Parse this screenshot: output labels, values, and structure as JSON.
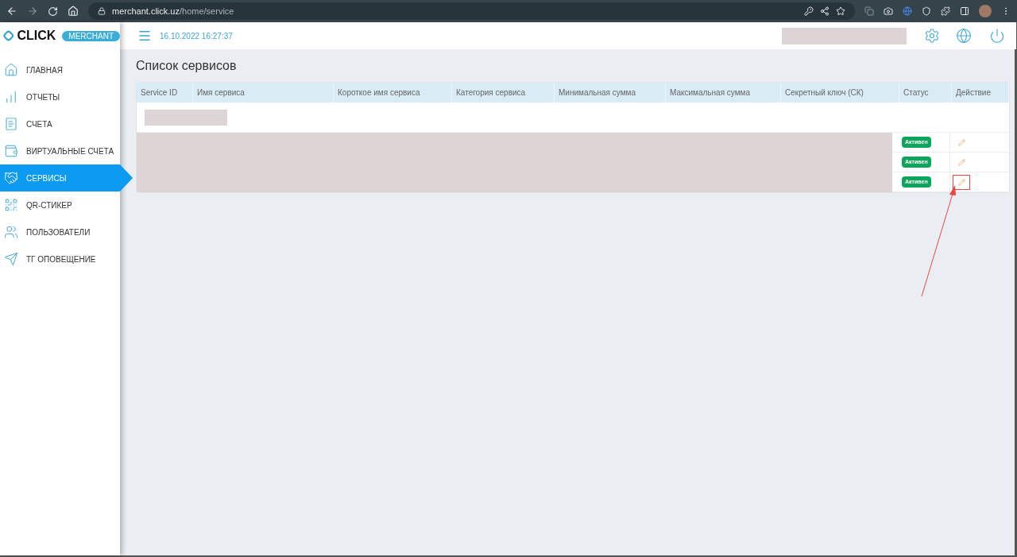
{
  "browser": {
    "url_host": "merchant.click.uz",
    "url_path": "/home/service"
  },
  "logo": {
    "name": "CLICK",
    "badge": "MERCHANT"
  },
  "header": {
    "datetime": "16.10.2022 16:27:37"
  },
  "sidebar": {
    "items": [
      {
        "label": "ГЛАВНАЯ",
        "selected": false
      },
      {
        "label": "ОТЧЕТЫ",
        "selected": false
      },
      {
        "label": "СЧЕТА",
        "selected": false
      },
      {
        "label": "ВИРТУАЛЬНЫЕ СЧЕТА",
        "selected": false
      },
      {
        "label": "СЕРВИСЫ",
        "selected": true
      },
      {
        "label": "QR-СТИКЕР",
        "selected": false
      },
      {
        "label": "ПОЛЬЗОВАТЕЛИ",
        "selected": false
      },
      {
        "label": "ТГ ОПОВЕЩЕНИЕ",
        "selected": false
      }
    ]
  },
  "page": {
    "title": "Список сервисов"
  },
  "table": {
    "columns": [
      "Service ID",
      "Имя сервиса",
      "Короткое имя сервиса",
      "Категория сервиса",
      "Минимальная сумма",
      "Максимальная сумма",
      "Секретный ключ (СК)",
      "Статус",
      "Действие"
    ],
    "rows": [
      {
        "status": "Активен",
        "highlighted": false
      },
      {
        "status": "Активен",
        "highlighted": false
      },
      {
        "status": "Активен",
        "highlighted": true
      }
    ]
  }
}
